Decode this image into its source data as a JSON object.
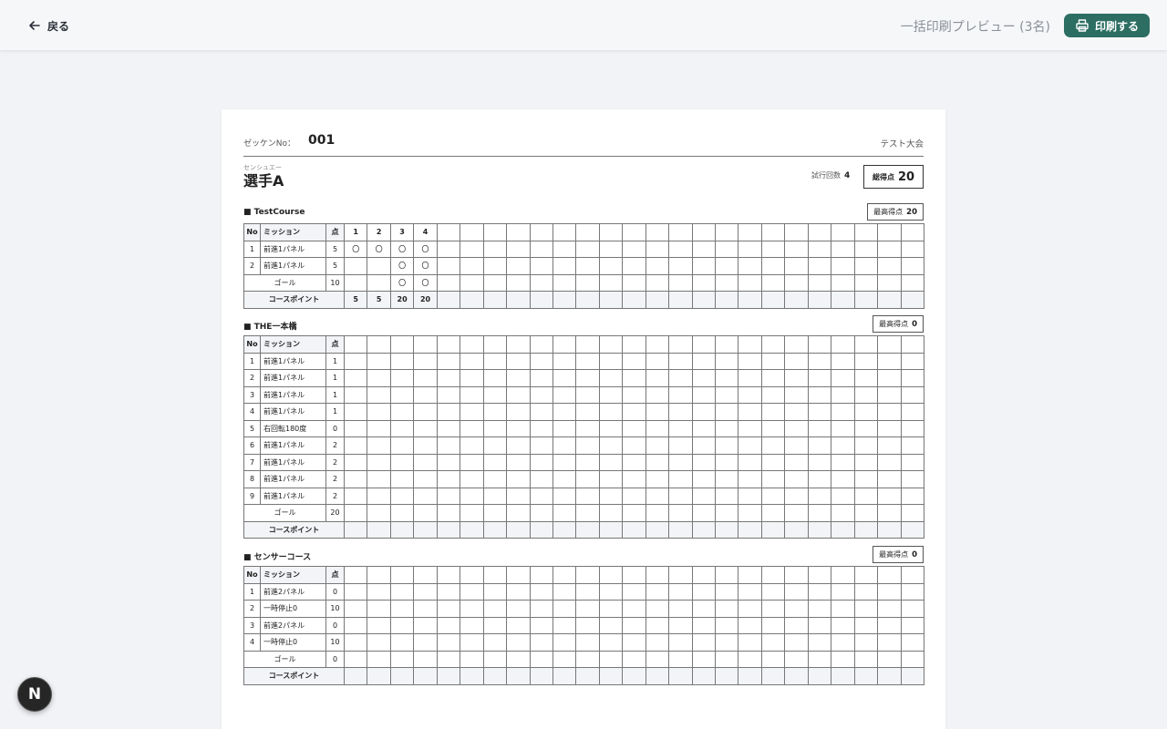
{
  "topbar": {
    "back_label": "戻る",
    "preview_title": "一括印刷プレビュー (3名)",
    "print_label": "印刷する"
  },
  "sheet": {
    "bib_label": "ゼッケンNo：",
    "bib_value": "001",
    "tournament": "テスト大会",
    "name_kana": "センシュエー",
    "name": "選手A",
    "attempts_label": "試行回数",
    "attempts_value": "4",
    "total_label": "総得点",
    "total_value": "20",
    "best_label": "最高得点",
    "col_no": "No",
    "col_mission": "ミッション",
    "col_points": "点",
    "sum_label": "コースポイント",
    "courses": [
      {
        "title": "■ TestCourse",
        "best": "20",
        "attempt_headers": [
          "1",
          "2",
          "3",
          "4"
        ],
        "rows": [
          {
            "no": "1",
            "mission": "前進1パネル",
            "points": "5",
            "marks": [
              "〇",
              "〇",
              "〇",
              "〇"
            ]
          },
          {
            "no": "2",
            "mission": "前進1パネル",
            "points": "5",
            "marks": [
              "",
              "",
              "〇",
              "〇"
            ]
          },
          {
            "no": "",
            "mission": "ゴール",
            "points": "10",
            "marks": [
              "",
              "",
              "〇",
              "〇"
            ]
          }
        ],
        "sums": [
          "5",
          "5",
          "20",
          "20"
        ]
      },
      {
        "title": "■ THE一本橋",
        "best": "0",
        "attempt_headers": [],
        "rows": [
          {
            "no": "1",
            "mission": "前進1パネル",
            "points": "1",
            "marks": []
          },
          {
            "no": "2",
            "mission": "前進1パネル",
            "points": "1",
            "marks": []
          },
          {
            "no": "3",
            "mission": "前進1パネル",
            "points": "1",
            "marks": []
          },
          {
            "no": "4",
            "mission": "前進1パネル",
            "points": "1",
            "marks": []
          },
          {
            "no": "5",
            "mission": "右回転180度",
            "points": "0",
            "marks": []
          },
          {
            "no": "6",
            "mission": "前進1パネル",
            "points": "2",
            "marks": []
          },
          {
            "no": "7",
            "mission": "前進1パネル",
            "points": "2",
            "marks": []
          },
          {
            "no": "8",
            "mission": "前進1パネル",
            "points": "2",
            "marks": []
          },
          {
            "no": "9",
            "mission": "前進1パネル",
            "points": "2",
            "marks": []
          },
          {
            "no": "",
            "mission": "ゴール",
            "points": "20",
            "marks": []
          }
        ],
        "sums": []
      },
      {
        "title": "■ センサーコース",
        "best": "0",
        "attempt_headers": [],
        "rows": [
          {
            "no": "1",
            "mission": "前進2パネル",
            "points": "0",
            "marks": []
          },
          {
            "no": "2",
            "mission": "一時停止0",
            "points": "10",
            "marks": []
          },
          {
            "no": "3",
            "mission": "前進2パネル",
            "points": "0",
            "marks": []
          },
          {
            "no": "4",
            "mission": "一時停止0",
            "points": "10",
            "marks": []
          },
          {
            "no": "",
            "mission": "ゴール",
            "points": "0",
            "marks": []
          }
        ],
        "sums": []
      }
    ]
  },
  "badge": {
    "label": "N"
  }
}
